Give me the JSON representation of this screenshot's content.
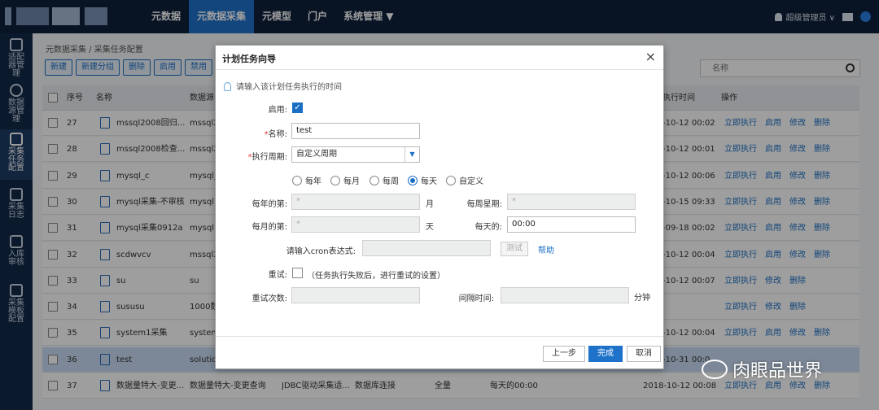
{
  "topbar": {
    "nav": [
      "元数据",
      "元数据采集",
      "元模型",
      "门户",
      "系统管理 ▼"
    ],
    "user": "超级管理员 ∨"
  },
  "sidebar": [
    {
      "label": "适配器管理",
      "icon": "plug-icon"
    },
    {
      "label": "数据源管理",
      "icon": "database-icon"
    },
    {
      "label": "采集任务配置",
      "icon": "task-icon"
    },
    {
      "label": "采集日志",
      "icon": "log-icon"
    },
    {
      "label": "入库审核",
      "icon": "audit-icon"
    },
    {
      "label": "采集模板配置",
      "icon": "template-icon"
    }
  ],
  "breadcrumb": "元数据采集 / 采集任务配置",
  "toolbar": [
    "新建",
    "新建分组",
    "删除",
    "启用",
    "禁用"
  ],
  "search": {
    "placeholder": "名称"
  },
  "table": {
    "headers": {
      "seq": "序号",
      "name": "名称",
      "source": "数据源",
      "time": "执行时间",
      "ops": "操作"
    },
    "rows": [
      {
        "seq": "27",
        "name": "mssql2008回归...",
        "source": "mssql2",
        "time": "-10-12 00:02",
        "ops": [
          "立即执行",
          "启用",
          "修改",
          "删除"
        ]
      },
      {
        "seq": "28",
        "name": "mssql2008检查...",
        "source": "mssql2",
        "time": "-10-12 00:01",
        "ops": [
          "立即执行",
          "启用",
          "修改",
          "删除"
        ]
      },
      {
        "seq": "29",
        "name": "mysql_c",
        "source": "mysql_",
        "time": "-10-12 00:06",
        "ops": [
          "立即执行",
          "启用",
          "修改",
          "删除"
        ]
      },
      {
        "seq": "30",
        "name": "mysql采集-不审核",
        "source": "mysql",
        "time": "-10-15 09:33",
        "ops": [
          "立即执行",
          "启用",
          "修改",
          "删除"
        ]
      },
      {
        "seq": "31",
        "name": "mysql采集0912a",
        "source": "mysql",
        "time": "-09-18 00:02",
        "ops": [
          "立即执行",
          "启用",
          "修改",
          "删除"
        ]
      },
      {
        "seq": "32",
        "name": "scdwvcv",
        "source": "mssql2",
        "time": "-10-12 00:04",
        "ops": [
          "立即执行",
          "启用",
          "修改",
          "删除"
        ]
      },
      {
        "seq": "33",
        "name": "su",
        "source": "su",
        "time": "-10-12 00:07",
        "ops": [
          "立即执行",
          "修改",
          "删除"
        ]
      },
      {
        "seq": "34",
        "name": "sususu",
        "source": "1000数",
        "time": "",
        "ops": [
          "立即执行",
          "修改",
          "删除"
        ]
      },
      {
        "seq": "35",
        "name": "system1采集",
        "source": "system",
        "time": "-10-12 00:04",
        "ops": [
          "立即执行",
          "启用",
          "修改",
          "删除"
        ]
      },
      {
        "seq": "36",
        "name": "test",
        "source": "solutio",
        "time": "-10-31 00:0",
        "ops": []
      },
      {
        "seq": "37",
        "name": "数据量特大-变更...",
        "source": "数据量特大-变更查询",
        "extra": [
          "JDBC驱动采集适...",
          "数据库连接",
          "全量",
          "每天的00:00"
        ],
        "time": "2018-10-12 00:08",
        "ops": [
          "立即执行",
          "启用",
          "修改",
          "删除"
        ]
      }
    ]
  },
  "dialog": {
    "title": "计划任务向导",
    "close": "×",
    "tip": "请输入该计划任务执行的时间",
    "enable_label": "启用:",
    "enable_checked": "✓",
    "name_label": "名称:",
    "name_value": "test",
    "cycle_label": "执行周期:",
    "cycle_value": "自定义周期",
    "radios": [
      "每年",
      "每月",
      "每周",
      "每天",
      "自定义"
    ],
    "radio_selected": "每天",
    "year_day_label": "每年的第:",
    "year_day_value": "*",
    "month_unit": "月",
    "weekday_label": "每周星期:",
    "weekday_value": "*",
    "month_day_label": "每月的第:",
    "month_day_value": "*",
    "day_unit": "天",
    "daily_label": "每天的:",
    "daily_value": "00:00",
    "cron_label": "请输入cron表达式:",
    "cron_value": "",
    "test_button": "测试",
    "help_link": "帮助",
    "retry_label": "重试:",
    "retry_hint": "（任务执行失败后，进行重试的设置）",
    "retry_count_label": "重试次数:",
    "interval_label": "间隔时间:",
    "interval_unit": "分钟",
    "prev_button": "上一步",
    "finish_button": "完成",
    "cancel_button": "取消"
  },
  "watermark": "肉眼品世界"
}
